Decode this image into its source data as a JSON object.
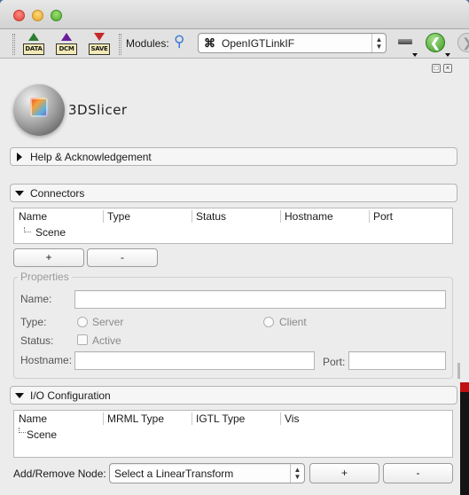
{
  "toolbar": {
    "data_label": "DATA",
    "dcm_label": "DCM",
    "save_label": "SAVE",
    "modules_label": "Modules:",
    "module_name": "OpenIGTLinkIF",
    "module_icon_glyph": "⌘"
  },
  "logo": {
    "text": "3DSlicer"
  },
  "sections": {
    "help": {
      "label": "Help & Acknowledgement"
    },
    "connectors": {
      "label": "Connectors"
    },
    "io": {
      "label": "I/O Configuration"
    }
  },
  "connectors_table": {
    "columns": [
      "Name",
      "Type",
      "Status",
      "Hostname",
      "Port"
    ],
    "root": "Scene"
  },
  "connector_buttons": {
    "add": "+",
    "remove": "-"
  },
  "properties": {
    "title": "Properties",
    "name_label": "Name:",
    "name_value": "",
    "type_label": "Type:",
    "server_label": "Server",
    "client_label": "Client",
    "status_label": "Status:",
    "active_label": "Active",
    "hostname_label": "Hostname:",
    "hostname_value": "",
    "port_label": "Port:",
    "port_value": ""
  },
  "io_table": {
    "columns": [
      "Name",
      "MRML Type",
      "IGTL Type",
      "Vis"
    ],
    "root": "Scene"
  },
  "add_remove": {
    "label": "Add/Remove Node:",
    "select_value": "Select a LinearTransform",
    "add": "+",
    "remove": "-"
  },
  "colors": {
    "close": "#e0443b",
    "minimize": "#e4a72a",
    "maximize": "#4ea833",
    "back_arrow": "#3c9a24"
  }
}
